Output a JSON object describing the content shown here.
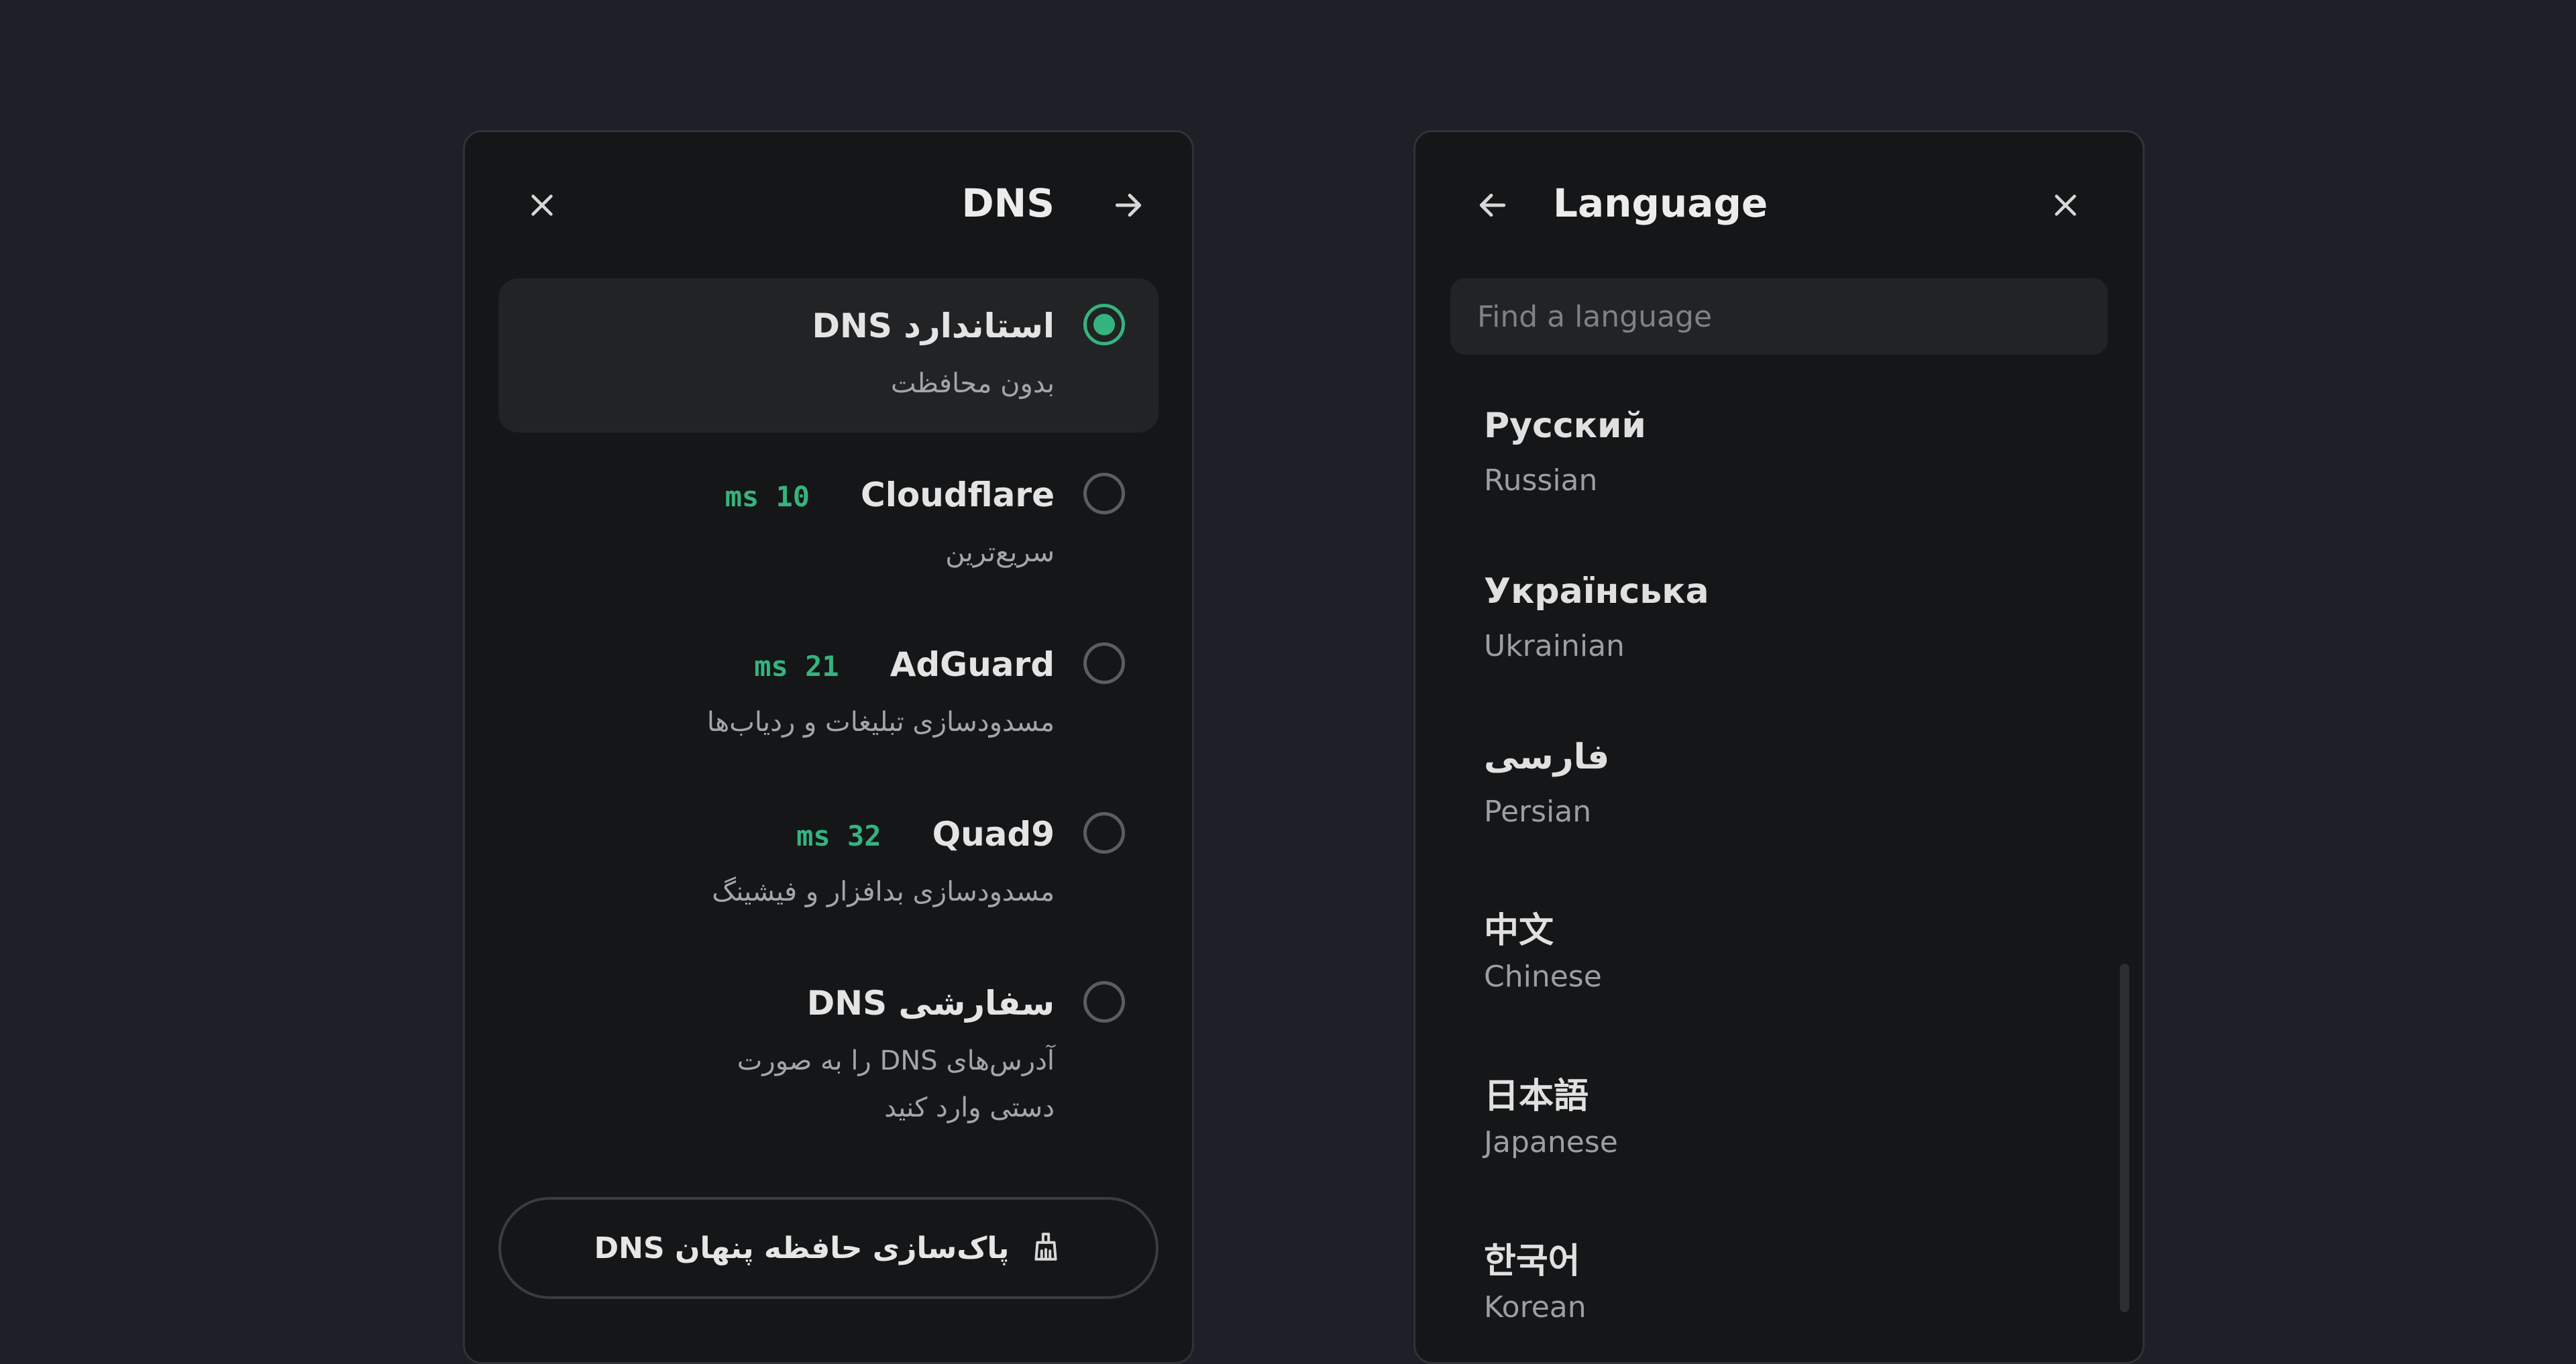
{
  "dns_panel": {
    "title": "DNS",
    "close_icon": "close-icon",
    "forward_icon": "arrow-right-icon",
    "options": [
      {
        "name": "DNS استاندارد",
        "description": "بدون محافظت",
        "latency": "",
        "selected": true
      },
      {
        "name": "Cloudflare",
        "description": "سریع‌ترین",
        "latency": "ms 10",
        "selected": false
      },
      {
        "name": "AdGuard",
        "description": "مسدودسازی تبلیغات و ردیاب‌ها",
        "latency": "ms 21",
        "selected": false
      },
      {
        "name": "Quad9",
        "description": "مسدودسازی بدافزار و فیشینگ",
        "latency": "ms 32",
        "selected": false
      },
      {
        "name": "DNS سفارشی",
        "description": "آدرس‌های DNS را به صورت دستی وارد کنید",
        "latency": "",
        "selected": false
      }
    ],
    "flush_button": {
      "label": "پاک‌سازی حافظه پنهان DNS",
      "icon": "broom-icon"
    }
  },
  "language_panel": {
    "title": "Language",
    "back_icon": "arrow-left-icon",
    "close_icon": "close-icon",
    "search_placeholder": "Find a language",
    "languages": [
      {
        "native": "Русский",
        "english": "Russian"
      },
      {
        "native": "Українська",
        "english": "Ukrainian"
      },
      {
        "native": "فارسی",
        "english": "Persian"
      },
      {
        "native": "中文",
        "english": "Chinese"
      },
      {
        "native": "日本語",
        "english": "Japanese"
      },
      {
        "native": "한국어",
        "english": "Korean"
      }
    ]
  },
  "colors": {
    "background": "#1d2026",
    "panel": "#151617",
    "selected_row": "#222325",
    "accent_green": "#35b37e"
  }
}
